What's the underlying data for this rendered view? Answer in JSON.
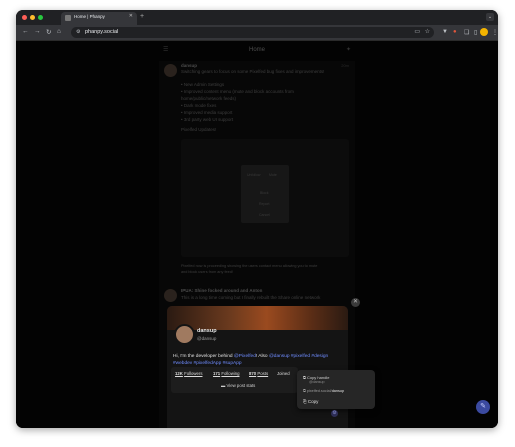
{
  "browser": {
    "tab_title": "Home | Phanpy",
    "tab_close": "✕",
    "new_tab": "+",
    "url": "phanpy.social",
    "back": "←",
    "forward": "→",
    "reload": "↻",
    "home": "⌂",
    "menu": "⋮"
  },
  "app": {
    "header_title": "Home",
    "left_icon": "☰",
    "right_icon": "✦"
  },
  "posts": [
    {
      "author": "dansup",
      "time": "20m",
      "title": "Switching gears to focus on some Pixelfed bug fixes and improvements!",
      "lines": [
        "• New Admin Settings",
        "• Improved content menu (mute and block accounts from",
        "home/public/network feeds)",
        "• Dark mode fixes",
        "• Improved media support",
        "• 3rd party web UI support",
        "Pixelfed Updates!"
      ],
      "caption_1": "Pixelfed now is proceeding showing the users contact menu allowing you to mute",
      "caption_2": "and block users from any feed!",
      "menu_items": [
        "Unfollow",
        "Mute",
        "Block",
        "Report",
        "Cancel"
      ]
    },
    {
      "author": "IPUA: Shine focked around and Anton",
      "body": "This is a long time coming but I finally rebuilt the Share online network"
    }
  ],
  "profile": {
    "display_name": "dansup",
    "handle": "@dansup",
    "bio_1_a": "Hi, I'm the developer behind ",
    "bio_1_b": "@Pixelfed",
    "bio_1_c": "! Also ",
    "bio_1_d": "@dansup #pixelfed #design",
    "bio_2": "#webdev #pixelfedApp #supApp",
    "followers_count": "12K",
    "followers_label": "Followers",
    "following_count": "171",
    "following_label": "Following",
    "posts_count": "870",
    "posts_label": "Posts",
    "joined_label": "Joined",
    "view_post_stats": "View post stats",
    "close": "✕"
  },
  "context_menu": {
    "copy_handle_label": "Copy handle",
    "copy_handle_sub": "@dansup",
    "instance_handle_a": "pixelfed.social/",
    "instance_handle_b": "dansup",
    "copy_label": "Copy"
  },
  "colors": {
    "accent": "#6f8cff",
    "fab": "#3b4aa0"
  }
}
